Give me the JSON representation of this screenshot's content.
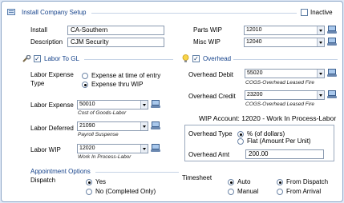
{
  "header": {
    "title": "Install Company Setup",
    "inactive_label": "Inactive",
    "inactive_checked": false
  },
  "top": {
    "install_label": "Install",
    "install_value": "CA-Southern",
    "description_label": "Description",
    "description_value": "CJM Security",
    "parts_wip_label": "Parts WIP",
    "parts_wip_value": "12010",
    "misc_wip_label": "Misc WIP",
    "misc_wip_value": "12040"
  },
  "labor": {
    "title": "Labor To GL",
    "enabled": true,
    "expense_type_label": "Labor Expense Type",
    "option_entry": "Expense at time of entry",
    "option_wip": "Expense thru WIP",
    "selected": "wip",
    "expense_label": "Labor Expense",
    "expense_value": "50010",
    "expense_desc": "Cost of Goods-Labor",
    "deferred_label": "Labor Deferred",
    "deferred_value": "21090",
    "deferred_desc": "Payroll Suspense",
    "wip_label": "Labor WIP",
    "wip_value": "12020",
    "wip_desc": "Work In Process-Labor"
  },
  "overhead": {
    "title": "Overhead",
    "enabled": true,
    "debit_label": "Overhead Debit",
    "debit_value": "55020",
    "debit_desc": "COGS-Overhead Leased Fire",
    "credit_label": "Overhead Credit",
    "credit_value": "23200",
    "credit_desc": "COGS-Overhead Leased Fire",
    "wip_account_text": "WIP Account: 12020 - Work In Process-Labor",
    "type_label": "Overhead Type",
    "type_option_percent": "% (of dollars)",
    "type_option_flat": "Flat (Amount Per Unit)",
    "type_selected": "percent",
    "amount_label": "Overhead Amt",
    "amount_value": "200.00"
  },
  "appointment": {
    "title": "Appointment Options",
    "dispatch_label": "Dispatch",
    "dispatch_yes": "Yes",
    "dispatch_no": "No (Completed Only)",
    "dispatch_selected": "yes",
    "timesheet_label": "Timesheet",
    "timesheet_auto": "Auto",
    "timesheet_manual": "Manual",
    "timesheet_mode_selected": "auto",
    "timesheet_from_dispatch": "From Dispatch",
    "timesheet_from_arrival": "From Arrival",
    "timesheet_source_selected": "dispatch"
  },
  "icons": {
    "panel": "panel-icon",
    "labor": "wrench-icon",
    "overhead": "lightbulb-icon",
    "lookup": "lookup-monitor-icon"
  },
  "colors": {
    "section_title": "#15428b",
    "frame_border": "#8fa8c8"
  }
}
